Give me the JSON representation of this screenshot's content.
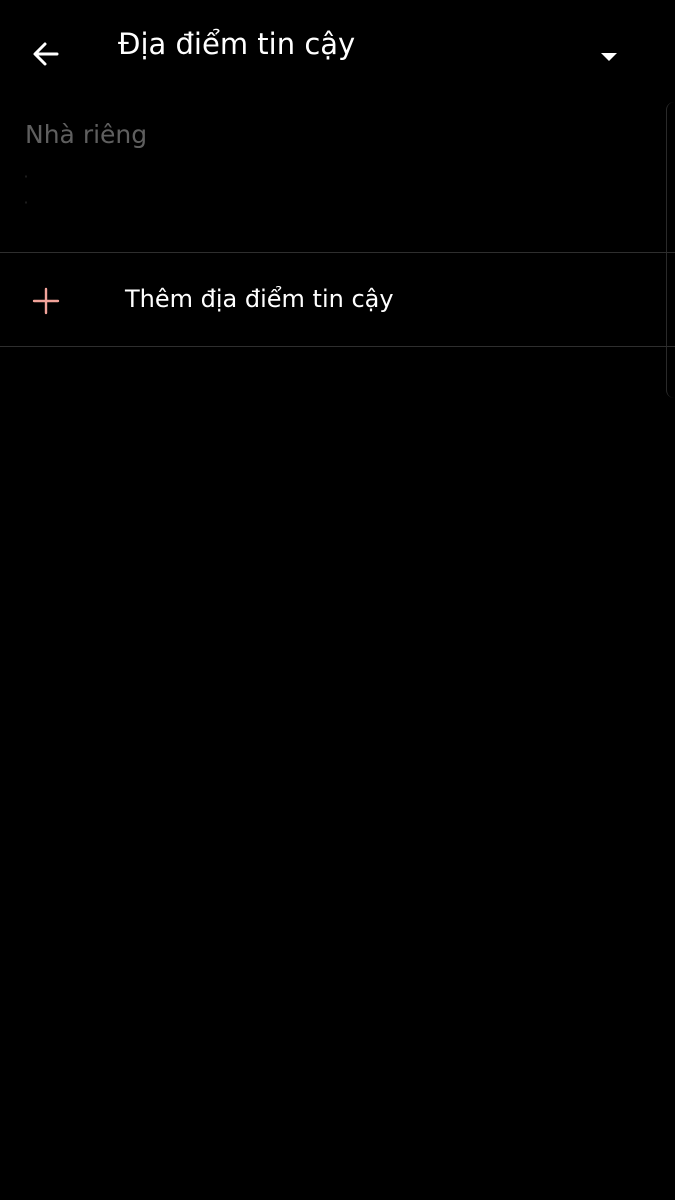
{
  "header": {
    "title": "Địa điểm tin cậy",
    "back_icon": "arrow-left-icon",
    "menu_icon": "caret-down-icon"
  },
  "home_section": {
    "label": "Nhà riêng"
  },
  "add_place": {
    "label": "Thêm địa điểm tin cậy",
    "icon": "plus-icon",
    "icon_color": "#f2a39a"
  },
  "colors": {
    "background": "#000000",
    "primary_text": "#ffffff",
    "secondary_text": "#5f5f5f",
    "divider": "#2e2e2e",
    "accent": "#f2a39a"
  }
}
